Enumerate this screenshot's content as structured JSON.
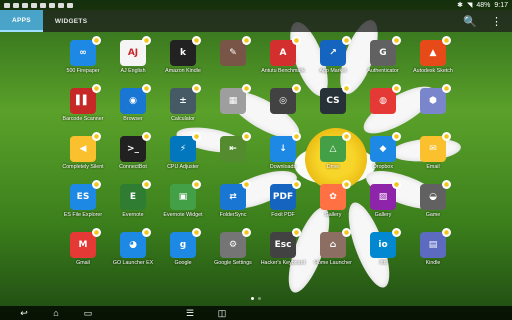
{
  "statusbar": {
    "battery": "48%",
    "time": "9:17"
  },
  "tabs": [
    {
      "label": "APPS"
    },
    {
      "label": "WIDGETS"
    }
  ],
  "actions": {
    "search_icon": "🔍",
    "menu_icon": "⋮"
  },
  "apps": [
    {
      "label": "500 Firepaper",
      "glyph": "∞",
      "color": "#1e88e5"
    },
    {
      "label": "AJ English",
      "glyph": "AJ",
      "color": "#f5f5f5"
    },
    {
      "label": "Amazon Kindle",
      "glyph": "k",
      "color": "#222"
    },
    {
      "label": "",
      "glyph": "✎",
      "color": "#795548"
    },
    {
      "label": "Antutu Benchmark",
      "glyph": "A",
      "color": "#d32f2f"
    },
    {
      "label": "App Market",
      "glyph": "↗",
      "color": "#1565c0"
    },
    {
      "label": "Authenticator",
      "glyph": "G",
      "color": "#616161"
    },
    {
      "label": "Autodesk Sketch",
      "glyph": "▲",
      "color": "#e64a19"
    },
    {
      "label": "Barcode Scanner",
      "glyph": "▌▌",
      "color": "#c62828"
    },
    {
      "label": "Browser",
      "glyph": "◉",
      "color": "#1976d2"
    },
    {
      "label": "Calculator",
      "glyph": "±",
      "color": "#455a64"
    },
    {
      "label": "",
      "glyph": "▦",
      "color": "#9e9e9e"
    },
    {
      "label": "",
      "glyph": "◎",
      "color": "#424242"
    },
    {
      "label": "",
      "glyph": "CS",
      "color": "#263238"
    },
    {
      "label": "",
      "glyph": "◍",
      "color": "#e53935"
    },
    {
      "label": "",
      "glyph": "⬢",
      "color": "#7986cb"
    },
    {
      "label": "Completely Silent",
      "glyph": "◀",
      "color": "#fbc02d"
    },
    {
      "label": "ConnectBot",
      "glyph": ">_",
      "color": "#212121"
    },
    {
      "label": "CPU Adjuster",
      "glyph": "⚡",
      "color": "#0277bd"
    },
    {
      "label": "",
      "glyph": "⇤",
      "color": "#558b2f"
    },
    {
      "label": "Downloads",
      "glyph": "↓",
      "color": "#1e88e5"
    },
    {
      "label": "Drive",
      "glyph": "△",
      "color": "#43a047"
    },
    {
      "label": "Dropbox",
      "glyph": "◆",
      "color": "#1e88e5"
    },
    {
      "label": "Email",
      "glyph": "✉",
      "color": "#fbc02d"
    },
    {
      "label": "ES File Explorer",
      "glyph": "ES",
      "color": "#1e88e5"
    },
    {
      "label": "Evernote",
      "glyph": "E",
      "color": "#2e7d32"
    },
    {
      "label": "Evernote Widget",
      "glyph": "▣",
      "color": "#43a047"
    },
    {
      "label": "FolderSync",
      "glyph": "⇄",
      "color": "#1976d2"
    },
    {
      "label": "Foxit PDF",
      "glyph": "PDF",
      "color": "#1565c0"
    },
    {
      "label": "Gallery",
      "glyph": "✿",
      "color": "#ff7043"
    },
    {
      "label": "Gallery",
      "glyph": "▨",
      "color": "#8e24aa"
    },
    {
      "label": "Game",
      "glyph": "◒",
      "color": "#616161"
    },
    {
      "label": "Gmail",
      "glyph": "M",
      "color": "#e53935"
    },
    {
      "label": "GO Launcher EX",
      "glyph": "◕",
      "color": "#1e88e5"
    },
    {
      "label": "Google",
      "glyph": "g",
      "color": "#1e88e5"
    },
    {
      "label": "Google Settings",
      "glyph": "⚙",
      "color": "#757575"
    },
    {
      "label": "Hacker's Keyboard",
      "glyph": "Esc",
      "color": "#424242"
    },
    {
      "label": "Home Launcher",
      "glyph": "⌂",
      "color": "#8d6e63"
    },
    {
      "label": "Ifttt",
      "glyph": "io",
      "color": "#0288d1"
    },
    {
      "label": "Kindle",
      "glyph": "▤",
      "color": "#5c6bc0"
    }
  ],
  "pager": {
    "pages": 2,
    "current": 1
  },
  "navbar": {
    "back": "↩",
    "home": "⌂",
    "recents": "▭",
    "menu": "☰",
    "apps": "◫"
  }
}
